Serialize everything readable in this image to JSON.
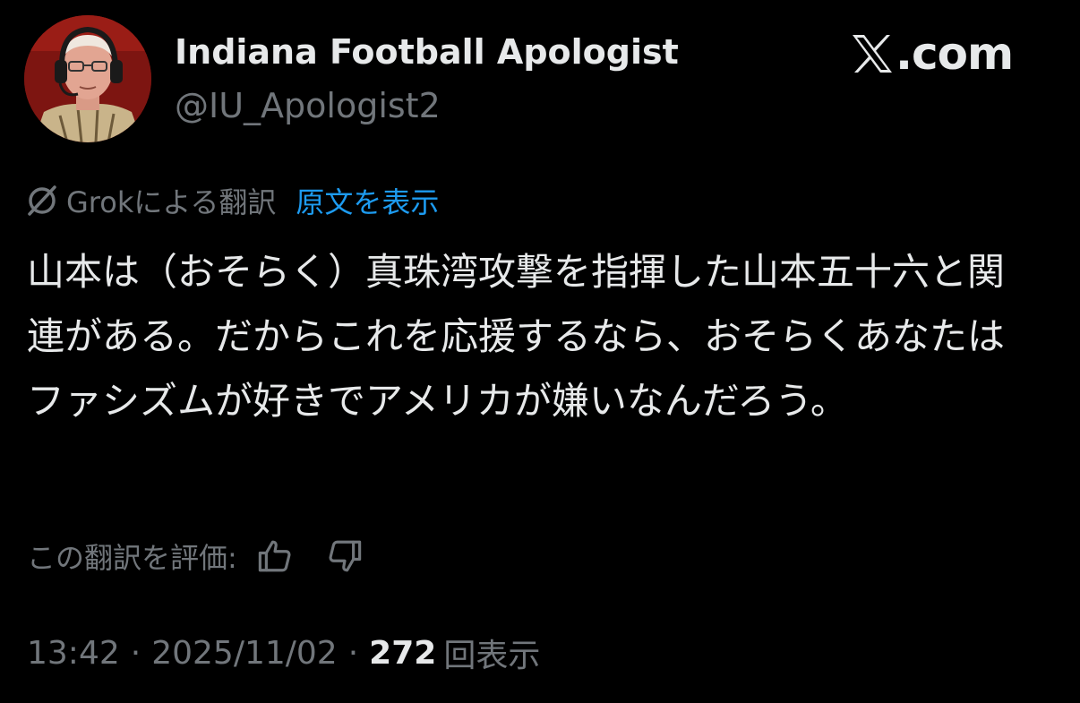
{
  "author": {
    "display_name": "Indiana Football Apologist",
    "handle": "@IU_Apologist2",
    "avatar_icon": "profile-photo"
  },
  "brand": {
    "text": ".com",
    "icon": "x-logo-icon"
  },
  "translation": {
    "icon": "grok-icon",
    "label": "Grokによる翻訳",
    "show_original": "原文を表示"
  },
  "tweet": {
    "text": "山本は（おそらく）真珠湾攻撃を指揮した山本五十六と関連がある。だからこれを応援するなら、おそらくあなたはファシズムが好きでアメリカが嫌いなんだろう。"
  },
  "rating": {
    "label": "この翻訳を評価:",
    "up_icon": "thumbs-up-icon",
    "down_icon": "thumbs-down-icon"
  },
  "meta": {
    "time": "13:42",
    "separator": "·",
    "date": "2025/11/02",
    "views_count": "272",
    "views_label": "回表示"
  },
  "colors": {
    "background": "#000000",
    "primary_text": "#e7e9ea",
    "secondary_text": "#71767b",
    "link": "#1d9bf0"
  }
}
